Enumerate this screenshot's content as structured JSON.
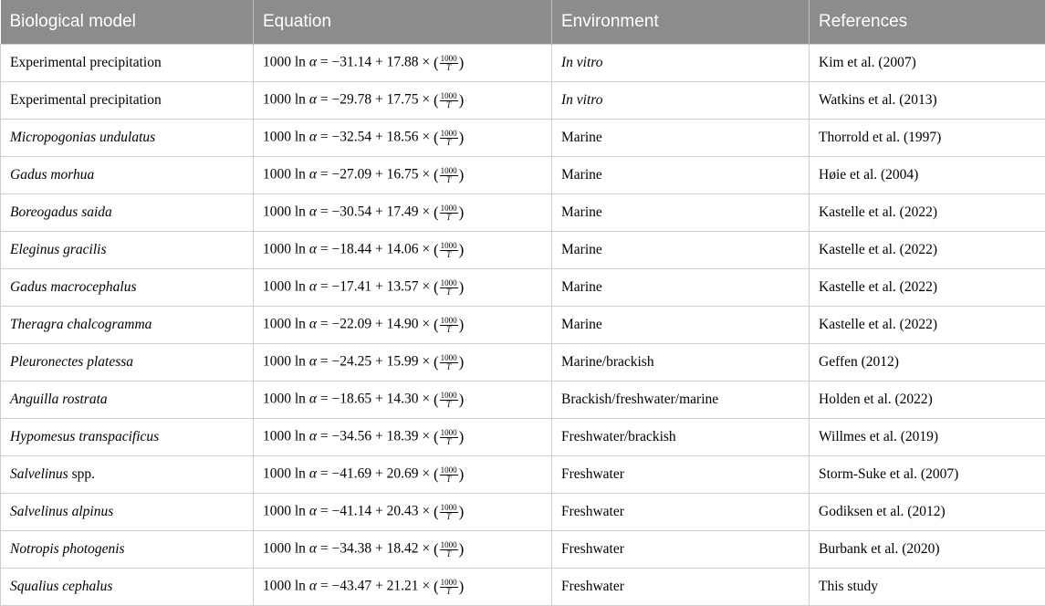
{
  "headers": [
    "Biological model",
    "Equation",
    "Environment",
    "References"
  ],
  "equation_parts": {
    "lhs": "1000 ln",
    "alpha": "α",
    "equals": "=",
    "times": "×",
    "frac_num": "1000",
    "frac_den": "T",
    "open_paren": "(",
    "close_paren": ")"
  },
  "rows": [
    {
      "model": "Experimental precipitation",
      "model_italic": false,
      "a": "−31.14",
      "b": "17.88",
      "environment": "In vitro",
      "env_italic": true,
      "reference": "Kim et al. (2007)"
    },
    {
      "model": "Experimental precipitation",
      "model_italic": false,
      "a": "−29.78",
      "b": "17.75",
      "environment": "In vitro",
      "env_italic": true,
      "reference": "Watkins et al. (2013)"
    },
    {
      "model": "Micropogonias undulatus",
      "model_italic": true,
      "a": "−32.54",
      "b": "18.56",
      "environment": "Marine",
      "env_italic": false,
      "reference": "Thorrold et al. (1997)"
    },
    {
      "model": "Gadus morhua",
      "model_italic": true,
      "a": "−27.09",
      "b": "16.75",
      "environment": "Marine",
      "env_italic": false,
      "reference": "Høie et al. (2004)"
    },
    {
      "model": "Boreogadus saida",
      "model_italic": true,
      "a": "−30.54",
      "b": "17.49",
      "environment": "Marine",
      "env_italic": false,
      "reference": "Kastelle et al. (2022)"
    },
    {
      "model": "Eleginus gracilis",
      "model_italic": true,
      "a": "−18.44",
      "b": "14.06",
      "environment": "Marine",
      "env_italic": false,
      "reference": "Kastelle et al. (2022)"
    },
    {
      "model": "Gadus macrocephalus",
      "model_italic": true,
      "a": "−17.41",
      "b": "13.57",
      "environment": "Marine",
      "env_italic": false,
      "reference": "Kastelle et al. (2022)"
    },
    {
      "model": "Theragra chalcogramma",
      "model_italic": true,
      "a": "−22.09",
      "b": "14.90",
      "environment": "Marine",
      "env_italic": false,
      "reference": "Kastelle et al. (2022)"
    },
    {
      "model": "Pleuronectes platessa",
      "model_italic": true,
      "a": "−24.25",
      "b": "15.99",
      "environment": "Marine/brackish",
      "env_italic": false,
      "reference": "Geffen (2012)"
    },
    {
      "model": "Anguilla rostrata",
      "model_italic": true,
      "a": "−18.65",
      "b": "14.30",
      "environment": "Brackish/freshwater/marine",
      "env_italic": false,
      "reference": "Holden et al. (2022)"
    },
    {
      "model": "Hypomesus transpacificus",
      "model_italic": true,
      "a": "−34.56",
      "b": "18.39",
      "environment": "Freshwater/brackish",
      "env_italic": false,
      "reference": "Willmes et al. (2019)"
    },
    {
      "model": "Salvelinus",
      "model_suffix": " spp.",
      "model_italic": true,
      "a": "−41.69",
      "b": "20.69",
      "environment": "Freshwater",
      "env_italic": false,
      "reference": "Storm-Suke et al. (2007)"
    },
    {
      "model": "Salvelinus alpinus",
      "model_italic": true,
      "a": "−41.14",
      "b": "20.43",
      "environment": "Freshwater",
      "env_italic": false,
      "reference": "Godiksen et al. (2012)"
    },
    {
      "model": "Notropis photogenis",
      "model_italic": true,
      "a": "−34.38",
      "b": "18.42",
      "environment": "Freshwater",
      "env_italic": false,
      "reference": "Burbank et al. (2020)"
    },
    {
      "model": "Squalius cephalus",
      "model_italic": true,
      "a": "−43.47",
      "b": "21.21",
      "environment": "Freshwater",
      "env_italic": false,
      "reference": "This study"
    }
  ]
}
